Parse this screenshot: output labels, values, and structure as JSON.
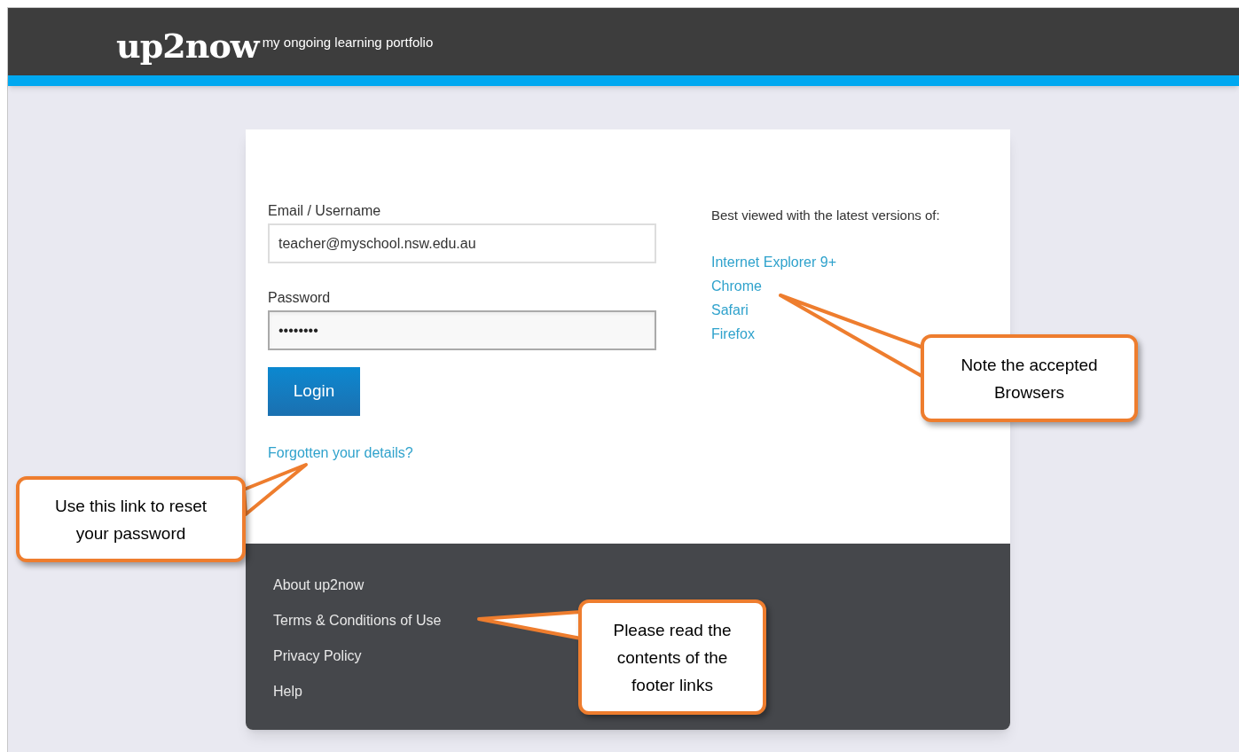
{
  "header": {
    "logo": "up2now",
    "tagline": "my ongoing learning portfolio"
  },
  "login": {
    "email_label": "Email / Username",
    "email_value": "teacher@myschool.nsw.edu.au",
    "password_label": "Password",
    "password_value": "••••••••",
    "button": "Login",
    "forgot_link": "Forgotten your details?"
  },
  "browsers": {
    "heading": "Best viewed with the latest versions of:",
    "items": [
      "Internet Explorer 9+",
      "Chrome",
      "Safari",
      "Firefox"
    ]
  },
  "footer_links": [
    "About up2now",
    "Terms & Conditions of Use",
    "Privacy Policy",
    "Help"
  ],
  "callouts": [
    {
      "text": "Use this link to reset your password"
    },
    {
      "text": "Note the accepted Browsers"
    },
    {
      "text": "Please read the contents of the footer links"
    }
  ]
}
